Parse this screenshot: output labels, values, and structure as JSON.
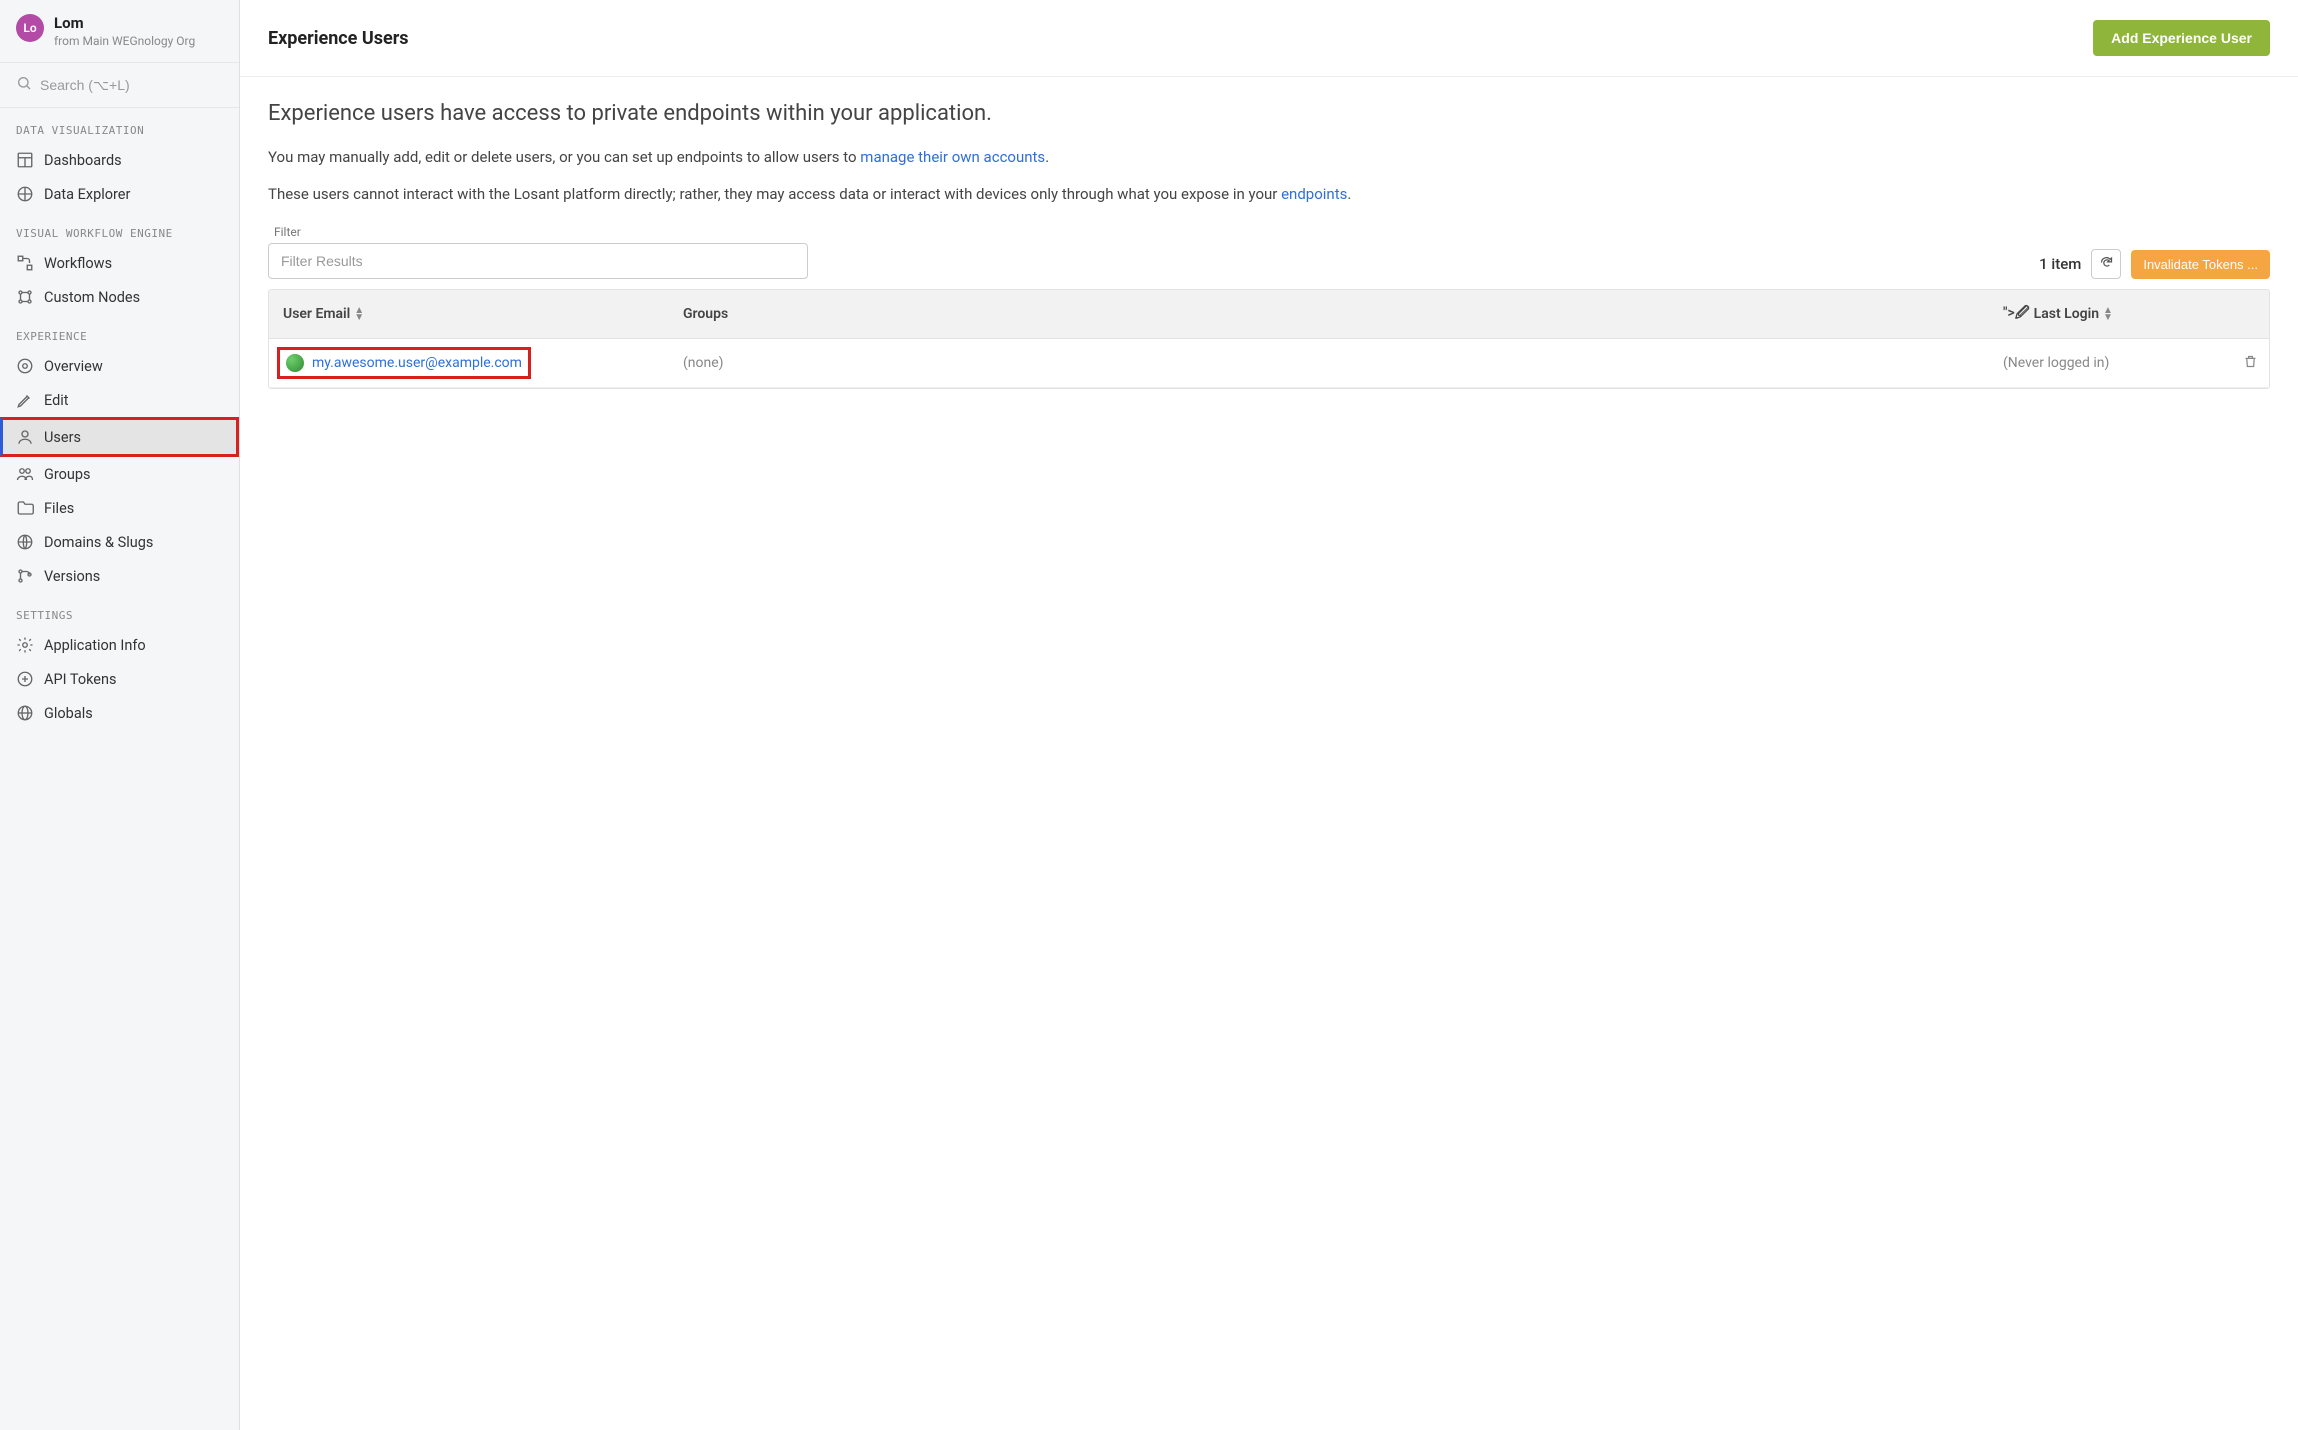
{
  "sidebar": {
    "avatar_initials": "Lo",
    "app_name": "Lom",
    "app_sub": "from Main WEGnology Org",
    "search_placeholder": "Search (⌥+L)",
    "sections": [
      {
        "label": "DATA VISUALIZATION",
        "items": [
          {
            "icon": "dashboard-icon",
            "label": "Dashboards"
          },
          {
            "icon": "explorer-icon",
            "label": "Data Explorer"
          }
        ]
      },
      {
        "label": "VISUAL WORKFLOW ENGINE",
        "items": [
          {
            "icon": "workflow-icon",
            "label": "Workflows"
          },
          {
            "icon": "custom-nodes-icon",
            "label": "Custom Nodes"
          }
        ]
      },
      {
        "label": "EXPERIENCE",
        "items": [
          {
            "icon": "overview-icon",
            "label": "Overview"
          },
          {
            "icon": "edit-icon",
            "label": "Edit"
          },
          {
            "icon": "user-icon",
            "label": "Users",
            "active": true,
            "highlight": true
          },
          {
            "icon": "groups-icon",
            "label": "Groups"
          },
          {
            "icon": "files-icon",
            "label": "Files"
          },
          {
            "icon": "globe-icon",
            "label": "Domains & Slugs"
          },
          {
            "icon": "branch-icon",
            "label": "Versions"
          }
        ]
      },
      {
        "label": "SETTINGS",
        "items": [
          {
            "icon": "gear-icon",
            "label": "Application Info"
          },
          {
            "icon": "api-icon",
            "label": "API Tokens"
          },
          {
            "icon": "globals-icon",
            "label": "Globals"
          }
        ]
      }
    ]
  },
  "header": {
    "title": "Experience Users",
    "add_button": "Add Experience User"
  },
  "intro": {
    "big": "Experience users have access to private endpoints within your application.",
    "p1_a": "You may manually add, edit or delete users, or you can set up endpoints to allow users to ",
    "p1_link": "manage their own accounts",
    "p1_b": ".",
    "p2_a": "These users cannot interact with the Losant platform directly; rather, they may access data or interact with devices only through what you expose in your ",
    "p2_link": "endpoints",
    "p2_b": "."
  },
  "filter": {
    "label": "Filter",
    "placeholder": "Filter Results"
  },
  "toolbar": {
    "count": "1 item",
    "invalidate": "Invalidate Tokens ..."
  },
  "table": {
    "col_email": "User Email",
    "col_groups": "Groups",
    "col_login": "Last Login",
    "rows": [
      {
        "email": "my.awesome.user@example.com",
        "groups": "(none)",
        "last_login": "(Never logged in)"
      }
    ]
  }
}
